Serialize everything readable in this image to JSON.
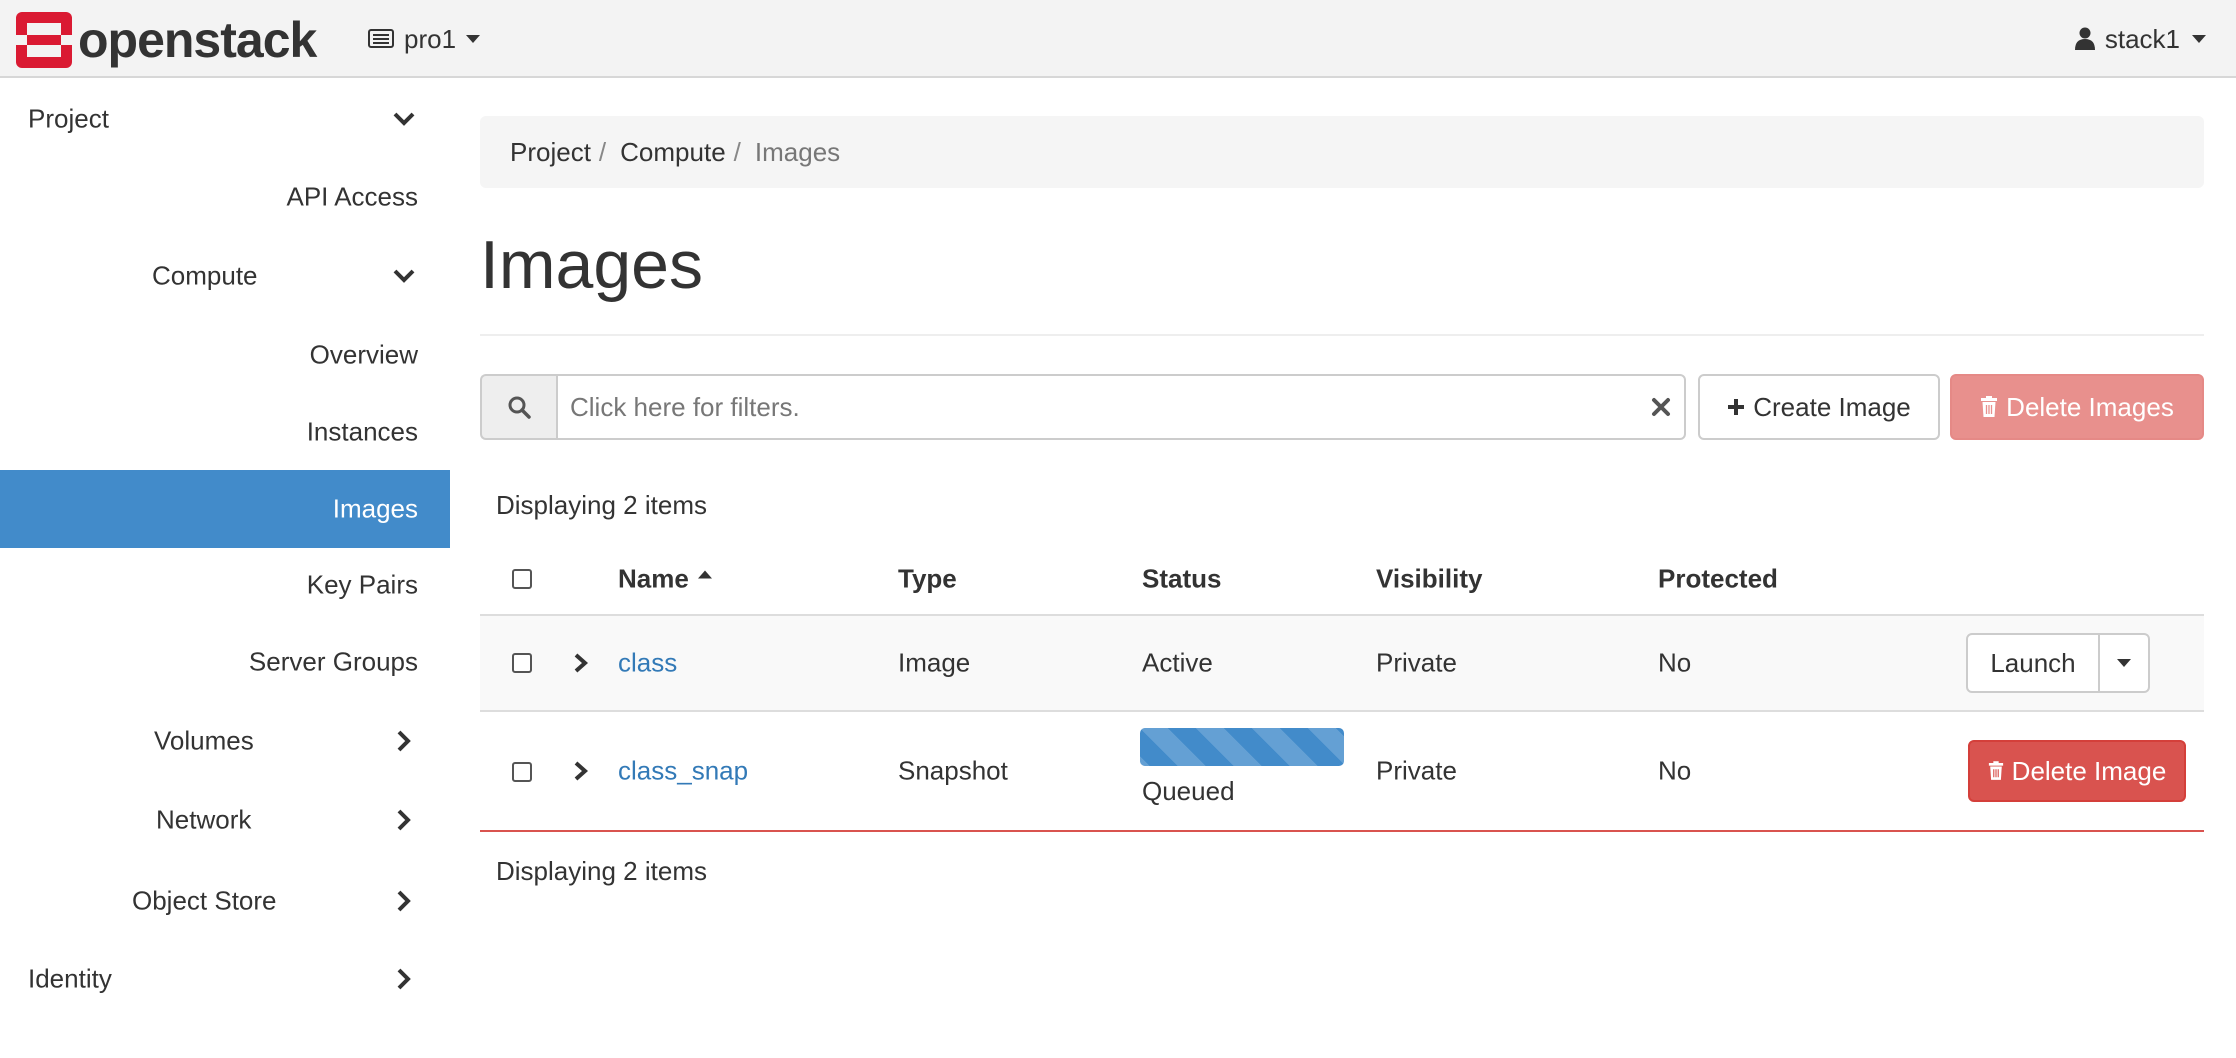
{
  "colors": {
    "brand_red": "#da1a32",
    "accent_blue": "#428bca",
    "link_blue": "#337ab7",
    "danger": "#d9534f"
  },
  "header": {
    "brand_text": "openstack",
    "project_switcher": {
      "icon": "server-icon",
      "label": "pro1"
    },
    "user_menu": {
      "icon": "user-icon",
      "label": "stack1"
    }
  },
  "sidebar": {
    "project": "Project",
    "api_access": "API Access",
    "compute": "Compute",
    "overview": "Overview",
    "instances": "Instances",
    "images": "Images",
    "key_pairs": "Key Pairs",
    "server_groups": "Server Groups",
    "volumes": "Volumes",
    "network": "Network",
    "object_store": "Object Store",
    "identity": "Identity"
  },
  "breadcrumb": {
    "items": [
      "Project",
      "Compute"
    ],
    "current": "Images"
  },
  "page": {
    "title": "Images"
  },
  "toolbar": {
    "filter_placeholder": "Click here for filters.",
    "create_label": "Create Image",
    "delete_label": "Delete Images"
  },
  "table": {
    "count_top": "Displaying 2 items",
    "count_bottom": "Displaying 2 items",
    "headers": {
      "name": "Name",
      "type": "Type",
      "status": "Status",
      "visibility": "Visibility",
      "protected": "Protected"
    },
    "rows": [
      {
        "name": "class",
        "type": "Image",
        "status": "Active",
        "visibility": "Private",
        "protected": "No",
        "action": "Launch"
      },
      {
        "name": "class_snap",
        "type": "Snapshot",
        "status": "Queued",
        "status_progress": 1.0,
        "visibility": "Private",
        "protected": "No",
        "action": "Delete Image"
      }
    ]
  }
}
